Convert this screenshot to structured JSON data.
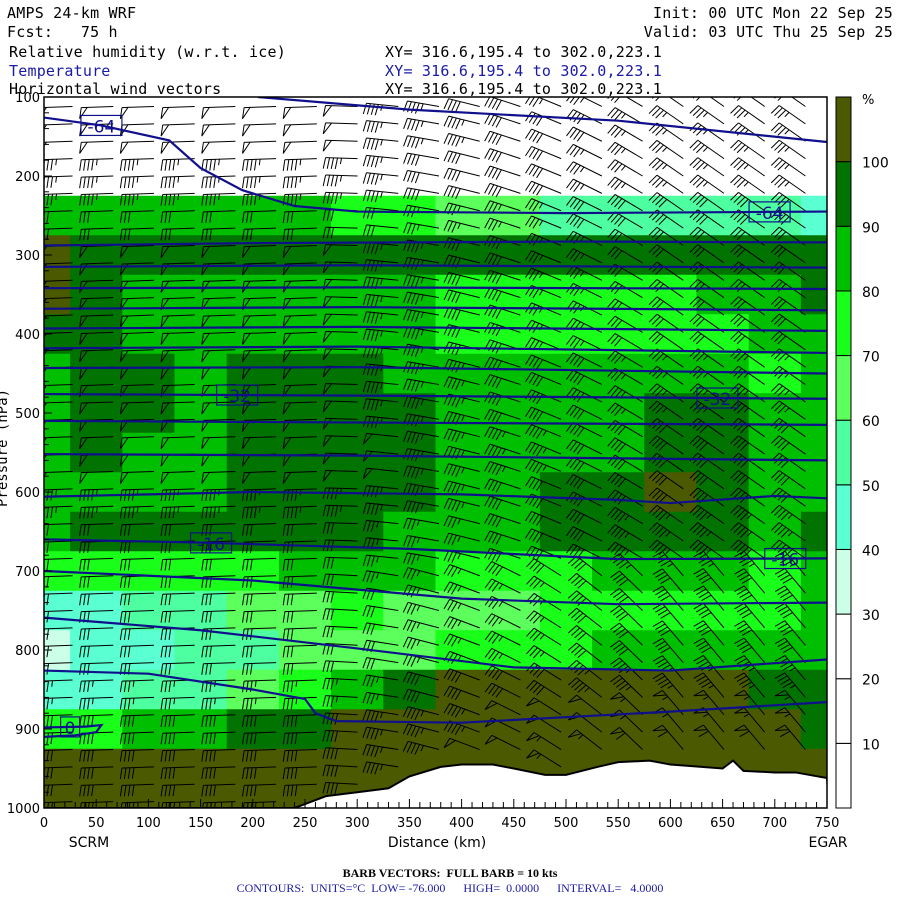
{
  "header": {
    "model": "AMPS 24-km WRF",
    "fcst": "Fcst:   75 h",
    "init": "Init: 00 UTC Mon 22 Sep 25",
    "valid": "Valid: 03 UTC Thu 25 Sep 25",
    "fields": [
      {
        "name": "Relative humidity (w.r.t. ice)",
        "xy": "XY= 316.6,195.4 to 302.0,223.1",
        "color": "#000000"
      },
      {
        "name": "Temperature",
        "xy": "XY= 316.6,195.4 to 302.0,223.1",
        "color": "#1a1aa6"
      },
      {
        "name": "Horizontal wind vectors",
        "xy": "XY= 316.6,195.4 to 302.0,223.1",
        "color": "#000000"
      }
    ]
  },
  "footer": {
    "barb": "BARB VECTORS:  FULL BARB = 10 kts",
    "contours": "CONTOURS:  UNITS=°C  LOW= -76.000      HIGH=  0.0000      INTERVAL=   4.0000"
  },
  "chart_data": {
    "type": "heatmap",
    "title": "Cross-section: RH (ice), Temperature, Wind",
    "xlabel": "Distance (km)",
    "ylabel": "Pressure (hPa)",
    "xlim": [
      0,
      750
    ],
    "ylim": [
      1000,
      100
    ],
    "xticks": [
      0,
      50,
      100,
      150,
      200,
      250,
      300,
      350,
      400,
      450,
      500,
      550,
      600,
      650,
      700,
      750
    ],
    "yticks": [
      100,
      200,
      300,
      400,
      500,
      600,
      700,
      800,
      900,
      1000
    ],
    "start_label": "SCRM",
    "end_label": "EGAR",
    "colorbar": {
      "unit": "%",
      "levels": [
        10,
        20,
        30,
        40,
        50,
        60,
        70,
        80,
        90,
        100
      ],
      "colors": [
        "#ffffff",
        "#ffffff",
        "#ffffff",
        "#ccffe8",
        "#5affd2",
        "#4dffa0",
        "#5cff5c",
        "#1aff1a",
        "#00bf00",
        "#007300",
        "#4b5a00"
      ]
    },
    "rh": {
      "distance_km": [
        0,
        50,
        100,
        150,
        200,
        250,
        300,
        350,
        400,
        450,
        500,
        550,
        600,
        650,
        700,
        750
      ],
      "pressure_hpa": [
        100,
        150,
        200,
        250,
        300,
        350,
        400,
        450,
        500,
        550,
        600,
        650,
        700,
        750,
        800,
        850,
        900,
        950,
        1000
      ],
      "values": [
        [
          10,
          10,
          10,
          10,
          10,
          10,
          10,
          10,
          10,
          10,
          10,
          10,
          10,
          10,
          10,
          10
        ],
        [
          10,
          10,
          10,
          10,
          10,
          10,
          10,
          10,
          10,
          10,
          10,
          10,
          10,
          10,
          10,
          10
        ],
        [
          20,
          20,
          20,
          20,
          20,
          20,
          20,
          20,
          20,
          20,
          20,
          20,
          20,
          20,
          20,
          20
        ],
        [
          85,
          85,
          85,
          85,
          85,
          85,
          75,
          75,
          65,
          65,
          55,
          55,
          55,
          55,
          55,
          45
        ],
        [
          105,
          95,
          95,
          95,
          95,
          95,
          95,
          95,
          95,
          95,
          95,
          95,
          95,
          95,
          95,
          95
        ],
        [
          105,
          95,
          85,
          85,
          85,
          85,
          85,
          85,
          75,
          75,
          75,
          75,
          75,
          85,
          85,
          95
        ],
        [
          95,
          95,
          85,
          85,
          85,
          85,
          85,
          85,
          75,
          75,
          75,
          75,
          75,
          75,
          85,
          85
        ],
        [
          85,
          95,
          95,
          85,
          95,
          95,
          95,
          85,
          85,
          85,
          85,
          85,
          85,
          85,
          75,
          85
        ],
        [
          85,
          95,
          95,
          85,
          95,
          95,
          95,
          95,
          85,
          85,
          85,
          85,
          95,
          95,
          85,
          85
        ],
        [
          85,
          95,
          85,
          85,
          95,
          95,
          95,
          95,
          85,
          85,
          85,
          85,
          95,
          95,
          85,
          85
        ],
        [
          85,
          85,
          85,
          85,
          95,
          95,
          95,
          95,
          85,
          85,
          95,
          95,
          105,
          95,
          85,
          85
        ],
        [
          85,
          95,
          95,
          95,
          95,
          95,
          95,
          85,
          85,
          85,
          95,
          95,
          95,
          95,
          85,
          95
        ],
        [
          75,
          75,
          75,
          75,
          75,
          85,
          85,
          85,
          75,
          75,
          75,
          85,
          85,
          85,
          75,
          85
        ],
        [
          45,
          45,
          55,
          55,
          65,
          65,
          75,
          65,
          65,
          65,
          75,
          75,
          75,
          75,
          75,
          85
        ],
        [
          35,
          45,
          45,
          55,
          55,
          65,
          65,
          65,
          75,
          75,
          75,
          85,
          85,
          85,
          85,
          85
        ],
        [
          45,
          45,
          55,
          55,
          65,
          75,
          85,
          95,
          105,
          105,
          105,
          105,
          105,
          105,
          95,
          95
        ],
        [
          75,
          75,
          85,
          85,
          95,
          95,
          105,
          105,
          105,
          105,
          105,
          105,
          105,
          105,
          105,
          95
        ],
        [
          105,
          105,
          105,
          105,
          105,
          105,
          105,
          105,
          105,
          105,
          105,
          105,
          105,
          105,
          105,
          105
        ],
        [
          105,
          105,
          105,
          105,
          105,
          105,
          105,
          105,
          105,
          105,
          105,
          105,
          105,
          105,
          105,
          105
        ]
      ]
    },
    "terrain_surface": {
      "distance_km": [
        0,
        240,
        250,
        270,
        300,
        330,
        350,
        380,
        400,
        430,
        450,
        480,
        500,
        530,
        550,
        580,
        600,
        630,
        650,
        660,
        670,
        700,
        720,
        750
      ],
      "pressure_hpa": [
        1000,
        1000,
        995,
        985,
        980,
        975,
        960,
        948,
        945,
        945,
        950,
        958,
        958,
        948,
        942,
        940,
        945,
        948,
        950,
        940,
        953,
        955,
        955,
        962
      ]
    },
    "temperature_contours": [
      {
        "value": -68,
        "points": [
          [
            205,
            100
          ],
          [
            350,
            116
          ],
          [
            550,
            130
          ],
          [
            750,
            157
          ]
        ]
      },
      {
        "value": -64,
        "label": "-64",
        "label_km": [
          55,
          695
        ],
        "points": [
          [
            0,
            126
          ],
          [
            55,
            136
          ],
          [
            120,
            155
          ],
          [
            150,
            190
          ],
          [
            190,
            218
          ],
          [
            240,
            238
          ],
          [
            300,
            245
          ],
          [
            500,
            247
          ],
          [
            750,
            245
          ]
        ]
      },
      {
        "value": -60,
        "points": [
          [
            0,
            288
          ],
          [
            200,
            285
          ],
          [
            500,
            283
          ],
          [
            750,
            284
          ]
        ]
      },
      {
        "value": -56,
        "points": [
          [
            0,
            315
          ],
          [
            300,
            313
          ],
          [
            750,
            316
          ]
        ]
      },
      {
        "value": -52,
        "points": [
          [
            0,
            342
          ],
          [
            300,
            341
          ],
          [
            750,
            343
          ]
        ]
      },
      {
        "value": -48,
        "points": [
          [
            0,
            368
          ],
          [
            300,
            366
          ],
          [
            750,
            370
          ]
        ]
      },
      {
        "value": -44,
        "points": [
          [
            0,
            393
          ],
          [
            300,
            391
          ],
          [
            750,
            396
          ]
        ]
      },
      {
        "value": -40,
        "points": [
          [
            0,
            418
          ],
          [
            300,
            416
          ],
          [
            750,
            424
          ]
        ]
      },
      {
        "value": -36,
        "points": [
          [
            0,
            443
          ],
          [
            300,
            442
          ],
          [
            750,
            450
          ]
        ]
      },
      {
        "value": -32,
        "label": "-32",
        "label_km": [
          185,
          645
        ],
        "points": [
          [
            0,
            476
          ],
          [
            300,
            478
          ],
          [
            750,
            482
          ]
        ]
      },
      {
        "value": -28,
        "points": [
          [
            0,
            510
          ],
          [
            300,
            512
          ],
          [
            750,
            515
          ]
        ]
      },
      {
        "value": -24,
        "points": [
          [
            0,
            552
          ],
          [
            300,
            554
          ],
          [
            750,
            560
          ]
        ]
      },
      {
        "value": -20,
        "points": [
          [
            0,
            606
          ],
          [
            200,
            600
          ],
          [
            400,
            603
          ],
          [
            550,
            610
          ],
          [
            600,
            614
          ],
          [
            700,
            605
          ],
          [
            750,
            608
          ]
        ]
      },
      {
        "value": -16,
        "label": "-16",
        "label_km": [
          160,
          710
        ],
        "points": [
          [
            0,
            660
          ],
          [
            150,
            664
          ],
          [
            350,
            672
          ],
          [
            550,
            685
          ],
          [
            750,
            684
          ]
        ]
      },
      {
        "value": -12,
        "points": [
          [
            0,
            700
          ],
          [
            200,
            712
          ],
          [
            400,
            735
          ],
          [
            550,
            742
          ],
          [
            750,
            740
          ]
        ]
      },
      {
        "value": -8,
        "points": [
          [
            0,
            759
          ],
          [
            150,
            775
          ],
          [
            300,
            798
          ],
          [
            450,
            822
          ],
          [
            600,
            826
          ],
          [
            750,
            812
          ]
        ]
      },
      {
        "value": -4,
        "points": [
          [
            0,
            826
          ],
          [
            100,
            830
          ],
          [
            200,
            850
          ],
          [
            250,
            862
          ],
          [
            260,
            880
          ],
          [
            280,
            890
          ],
          [
            400,
            892
          ],
          [
            600,
            878
          ],
          [
            750,
            866
          ]
        ]
      },
      {
        "value": 0,
        "label": "0",
        "label_km": [
          25
        ],
        "points": [
          [
            0,
            898
          ],
          [
            40,
            897
          ],
          [
            55,
            895
          ],
          [
            50,
            904
          ],
          [
            30,
            908
          ],
          [
            0,
            910
          ]
        ]
      }
    ],
    "wind": {
      "full_barb_kts": 10,
      "pressure_hpa": [
        100,
        150,
        200,
        250,
        300,
        350,
        400,
        450,
        500,
        550,
        600,
        650,
        700,
        750,
        800,
        850,
        900,
        950,
        1000
      ],
      "speed_west_kts": [
        50,
        50,
        45,
        30,
        50,
        50,
        50,
        50,
        50,
        50,
        45,
        30,
        30,
        30,
        30,
        35,
        40,
        40,
        40
      ],
      "speed_east_kts": [
        30,
        35,
        35,
        40,
        30,
        30,
        30,
        35,
        35,
        40,
        40,
        45,
        45,
        40,
        40,
        45,
        55,
        60,
        60
      ],
      "dir_west_deg": 268,
      "dir_east_deg": 305
    }
  }
}
